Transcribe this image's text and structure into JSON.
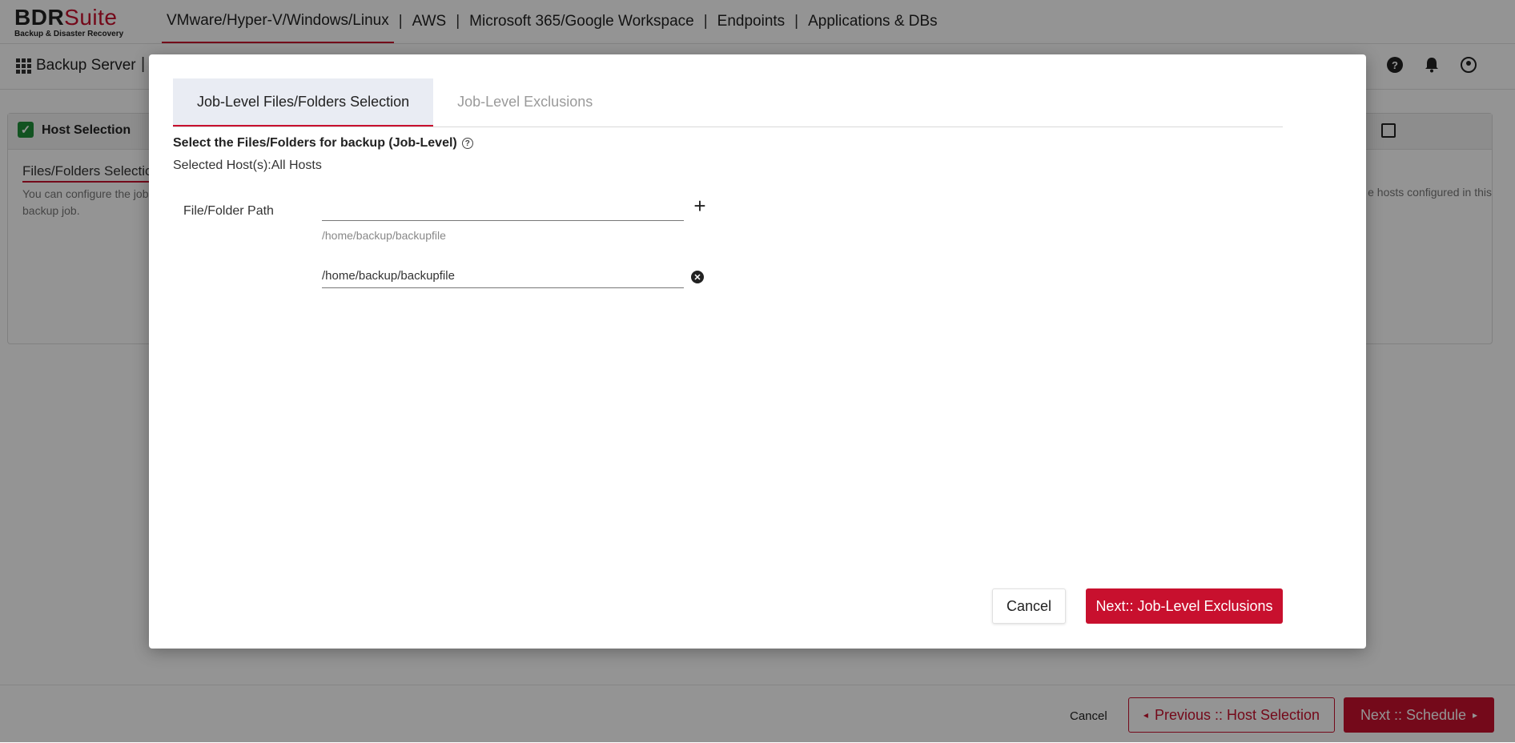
{
  "brand": {
    "name_main": "BDR",
    "name_suite": "Suite",
    "tagline": "Backup & Disaster Recovery",
    "accent": "#c8102e"
  },
  "topnav": {
    "items": [
      "VMware/Hyper-V/Windows/Linux",
      "AWS",
      "Microsoft 365/Google Workspace",
      "Endpoints",
      "Applications & DBs"
    ],
    "separator": "|",
    "active_index": 0
  },
  "subbar": {
    "backup_server": "Backup Server",
    "separator": "|",
    "icons": [
      "help-icon",
      "bell-icon",
      "user-icon"
    ]
  },
  "panel": {
    "title": "Host Selection",
    "subtitle": "Files/Folders Selectio",
    "desc_left": "You can configure the job backup job.",
    "desc_right": "e hosts configured in this"
  },
  "footer": {
    "cancel": "Cancel",
    "prev": "Previous :: Host Selection",
    "next": "Next :: Schedule"
  },
  "modal": {
    "tabs": [
      {
        "label": "Job-Level Files/Folders Selection",
        "active": true
      },
      {
        "label": "Job-Level Exclusions",
        "active": false
      }
    ],
    "section_title": "Select the Files/Folders for backup (Job-Level)",
    "selected_hosts_label": "Selected Host(s):All Hosts",
    "field_label": "File/Folder Path",
    "input": {
      "value": "",
      "placeholder": ""
    },
    "hint": "/home/backup/backupfile",
    "paths": [
      "/home/backup/backupfile"
    ],
    "cancel": "Cancel",
    "next": "Next:: Job-Level Exclusions"
  }
}
